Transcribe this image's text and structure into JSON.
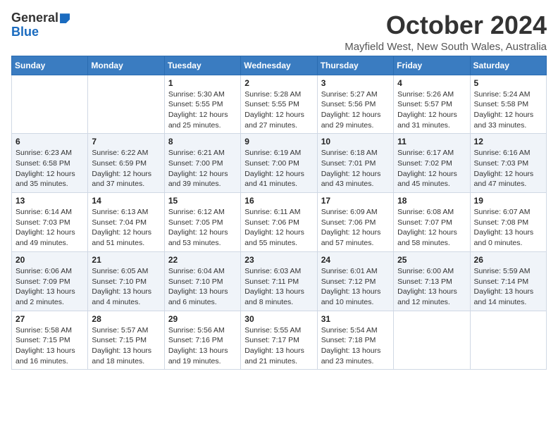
{
  "logo": {
    "general": "General",
    "blue": "Blue"
  },
  "title": "October 2024",
  "location": "Mayfield West, New South Wales, Australia",
  "days_of_week": [
    "Sunday",
    "Monday",
    "Tuesday",
    "Wednesday",
    "Thursday",
    "Friday",
    "Saturday"
  ],
  "weeks": [
    [
      {
        "day": "",
        "info": ""
      },
      {
        "day": "",
        "info": ""
      },
      {
        "day": "1",
        "info": "Sunrise: 5:30 AM\nSunset: 5:55 PM\nDaylight: 12 hours\nand 25 minutes."
      },
      {
        "day": "2",
        "info": "Sunrise: 5:28 AM\nSunset: 5:55 PM\nDaylight: 12 hours\nand 27 minutes."
      },
      {
        "day": "3",
        "info": "Sunrise: 5:27 AM\nSunset: 5:56 PM\nDaylight: 12 hours\nand 29 minutes."
      },
      {
        "day": "4",
        "info": "Sunrise: 5:26 AM\nSunset: 5:57 PM\nDaylight: 12 hours\nand 31 minutes."
      },
      {
        "day": "5",
        "info": "Sunrise: 5:24 AM\nSunset: 5:58 PM\nDaylight: 12 hours\nand 33 minutes."
      }
    ],
    [
      {
        "day": "6",
        "info": "Sunrise: 6:23 AM\nSunset: 6:58 PM\nDaylight: 12 hours\nand 35 minutes."
      },
      {
        "day": "7",
        "info": "Sunrise: 6:22 AM\nSunset: 6:59 PM\nDaylight: 12 hours\nand 37 minutes."
      },
      {
        "day": "8",
        "info": "Sunrise: 6:21 AM\nSunset: 7:00 PM\nDaylight: 12 hours\nand 39 minutes."
      },
      {
        "day": "9",
        "info": "Sunrise: 6:19 AM\nSunset: 7:00 PM\nDaylight: 12 hours\nand 41 minutes."
      },
      {
        "day": "10",
        "info": "Sunrise: 6:18 AM\nSunset: 7:01 PM\nDaylight: 12 hours\nand 43 minutes."
      },
      {
        "day": "11",
        "info": "Sunrise: 6:17 AM\nSunset: 7:02 PM\nDaylight: 12 hours\nand 45 minutes."
      },
      {
        "day": "12",
        "info": "Sunrise: 6:16 AM\nSunset: 7:03 PM\nDaylight: 12 hours\nand 47 minutes."
      }
    ],
    [
      {
        "day": "13",
        "info": "Sunrise: 6:14 AM\nSunset: 7:03 PM\nDaylight: 12 hours\nand 49 minutes."
      },
      {
        "day": "14",
        "info": "Sunrise: 6:13 AM\nSunset: 7:04 PM\nDaylight: 12 hours\nand 51 minutes."
      },
      {
        "day": "15",
        "info": "Sunrise: 6:12 AM\nSunset: 7:05 PM\nDaylight: 12 hours\nand 53 minutes."
      },
      {
        "day": "16",
        "info": "Sunrise: 6:11 AM\nSunset: 7:06 PM\nDaylight: 12 hours\nand 55 minutes."
      },
      {
        "day": "17",
        "info": "Sunrise: 6:09 AM\nSunset: 7:06 PM\nDaylight: 12 hours\nand 57 minutes."
      },
      {
        "day": "18",
        "info": "Sunrise: 6:08 AM\nSunset: 7:07 PM\nDaylight: 12 hours\nand 58 minutes."
      },
      {
        "day": "19",
        "info": "Sunrise: 6:07 AM\nSunset: 7:08 PM\nDaylight: 13 hours\nand 0 minutes."
      }
    ],
    [
      {
        "day": "20",
        "info": "Sunrise: 6:06 AM\nSunset: 7:09 PM\nDaylight: 13 hours\nand 2 minutes."
      },
      {
        "day": "21",
        "info": "Sunrise: 6:05 AM\nSunset: 7:10 PM\nDaylight: 13 hours\nand 4 minutes."
      },
      {
        "day": "22",
        "info": "Sunrise: 6:04 AM\nSunset: 7:10 PM\nDaylight: 13 hours\nand 6 minutes."
      },
      {
        "day": "23",
        "info": "Sunrise: 6:03 AM\nSunset: 7:11 PM\nDaylight: 13 hours\nand 8 minutes."
      },
      {
        "day": "24",
        "info": "Sunrise: 6:01 AM\nSunset: 7:12 PM\nDaylight: 13 hours\nand 10 minutes."
      },
      {
        "day": "25",
        "info": "Sunrise: 6:00 AM\nSunset: 7:13 PM\nDaylight: 13 hours\nand 12 minutes."
      },
      {
        "day": "26",
        "info": "Sunrise: 5:59 AM\nSunset: 7:14 PM\nDaylight: 13 hours\nand 14 minutes."
      }
    ],
    [
      {
        "day": "27",
        "info": "Sunrise: 5:58 AM\nSunset: 7:15 PM\nDaylight: 13 hours\nand 16 minutes."
      },
      {
        "day": "28",
        "info": "Sunrise: 5:57 AM\nSunset: 7:15 PM\nDaylight: 13 hours\nand 18 minutes."
      },
      {
        "day": "29",
        "info": "Sunrise: 5:56 AM\nSunset: 7:16 PM\nDaylight: 13 hours\nand 19 minutes."
      },
      {
        "day": "30",
        "info": "Sunrise: 5:55 AM\nSunset: 7:17 PM\nDaylight: 13 hours\nand 21 minutes."
      },
      {
        "day": "31",
        "info": "Sunrise: 5:54 AM\nSunset: 7:18 PM\nDaylight: 13 hours\nand 23 minutes."
      },
      {
        "day": "",
        "info": ""
      },
      {
        "day": "",
        "info": ""
      }
    ]
  ]
}
